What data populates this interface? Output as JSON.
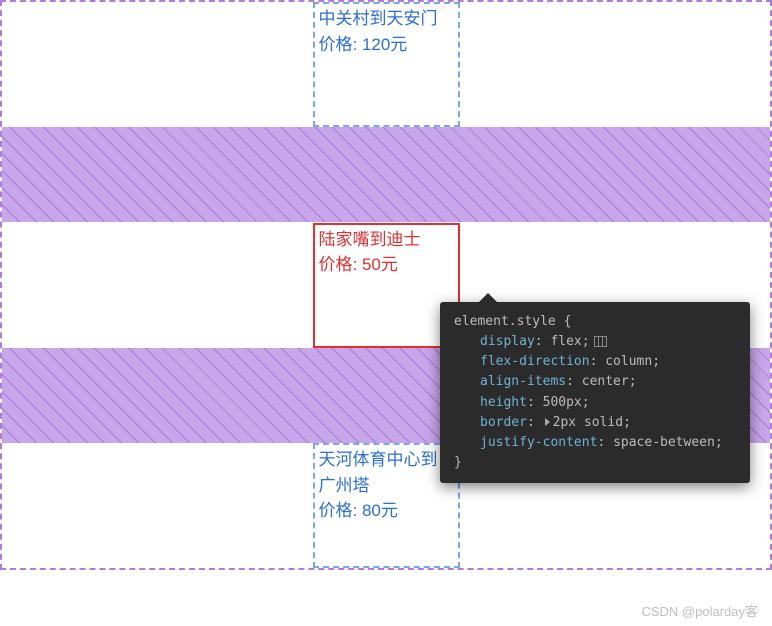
{
  "cards": [
    {
      "route": "中关村到天安门",
      "price": "价格: 120元"
    },
    {
      "route": "陆家嘴到迪士",
      "price": "价格: 50元"
    },
    {
      "route": "天河体育中心到广州塔",
      "price": "价格: 80元"
    }
  ],
  "devtools": {
    "selector": "element.style",
    "open_brace": "{",
    "close_brace": "}",
    "rules": [
      {
        "prop": "display",
        "val": "flex",
        "flexIcon": true
      },
      {
        "prop": "flex-direction",
        "val": "column"
      },
      {
        "prop": "align-items",
        "val": "center"
      },
      {
        "prop": "height",
        "val": "500px"
      },
      {
        "prop": "border",
        "val": "2px solid",
        "triangle": true
      },
      {
        "prop": "justify-content",
        "val": "space-between"
      }
    ]
  },
  "watermark": "CSDN @polarday客"
}
